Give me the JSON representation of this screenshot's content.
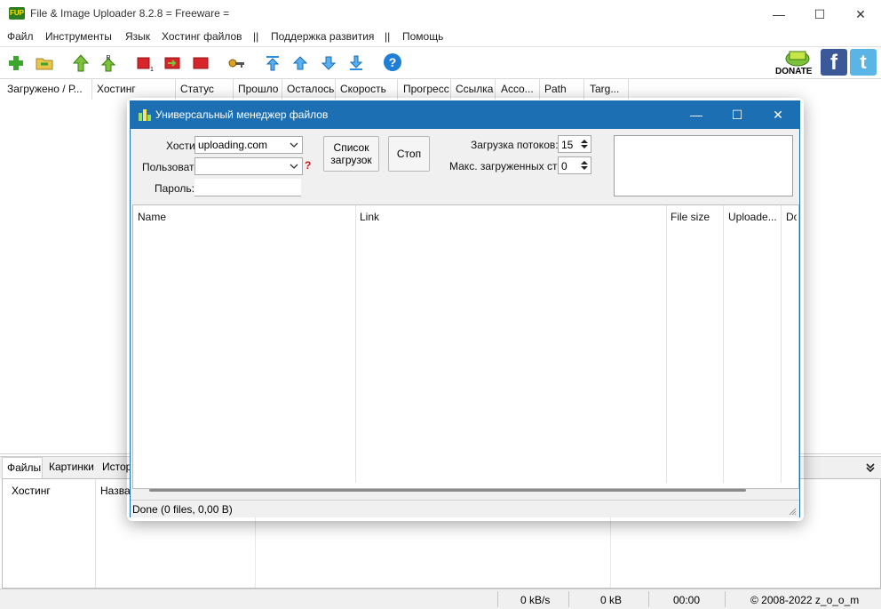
{
  "window": {
    "title": "File & Image Uploader 8.2.8  = Freeware =",
    "icon_text": "FUP",
    "controls": [
      "minimize-icon",
      "maximize-icon",
      "close-icon"
    ]
  },
  "menu": {
    "items": [
      "Файл",
      "Инструменты",
      "Язык",
      "Хостинг файлов",
      "||",
      "Поддержка развития",
      "||",
      "Помощь"
    ]
  },
  "toolbar": {
    "icons": [
      "add-icon",
      "folder-icon",
      "up-arrow-icon",
      "restart-icon",
      "stop-small-icon",
      "forward-icon",
      "stop-icon",
      "key-icon",
      "move-top-icon",
      "move-up-icon",
      "move-down-icon",
      "move-bottom-icon",
      "help-icon"
    ],
    "donate_label": "DONATE",
    "facebook_label": "f",
    "twitter_label": "t"
  },
  "main_grid": {
    "columns": [
      "Загружено / Р...",
      "Хостинг",
      "Статус",
      "Прошло",
      "Осталось",
      "Скорость",
      "Прогресс",
      "Ссылка",
      "Acco...",
      "Path",
      "Targ..."
    ]
  },
  "lower": {
    "tabs": [
      "Файлы",
      "Картинки",
      "Истор"
    ],
    "columns": [
      "Хостинг",
      "Назван"
    ]
  },
  "status_bar": {
    "speed": "0 kB/s",
    "size": "0 kB",
    "time": "00:00",
    "copyright": "© 2008-2022 z_o_o_m"
  },
  "dialog": {
    "title": "Универсальный менеджер файлов",
    "hosting_label": "Хостин",
    "hosting_value": "uploading.com",
    "user_label": "Пользовате",
    "user_value": "",
    "password_label": "Пароль:",
    "question_mark": "?",
    "list_button": "Список загрузок",
    "stop_button": "Стоп",
    "threads_label": "Загрузка потоков:",
    "threads_value": "15",
    "max_pages_label": "Макс. загруженных стр",
    "max_pages_value": "0",
    "file_columns": [
      "Name",
      "Link",
      "File size",
      "Uploade...",
      "Do"
    ],
    "status": "Done (0 files, 0,00 B)"
  },
  "colors": {
    "dialog_title_bar": "#1c6fb3",
    "toolbar_green": "#3aa62c",
    "toolbar_blue": "#2a8fe0",
    "toolbar_red": "#d8252a"
  }
}
